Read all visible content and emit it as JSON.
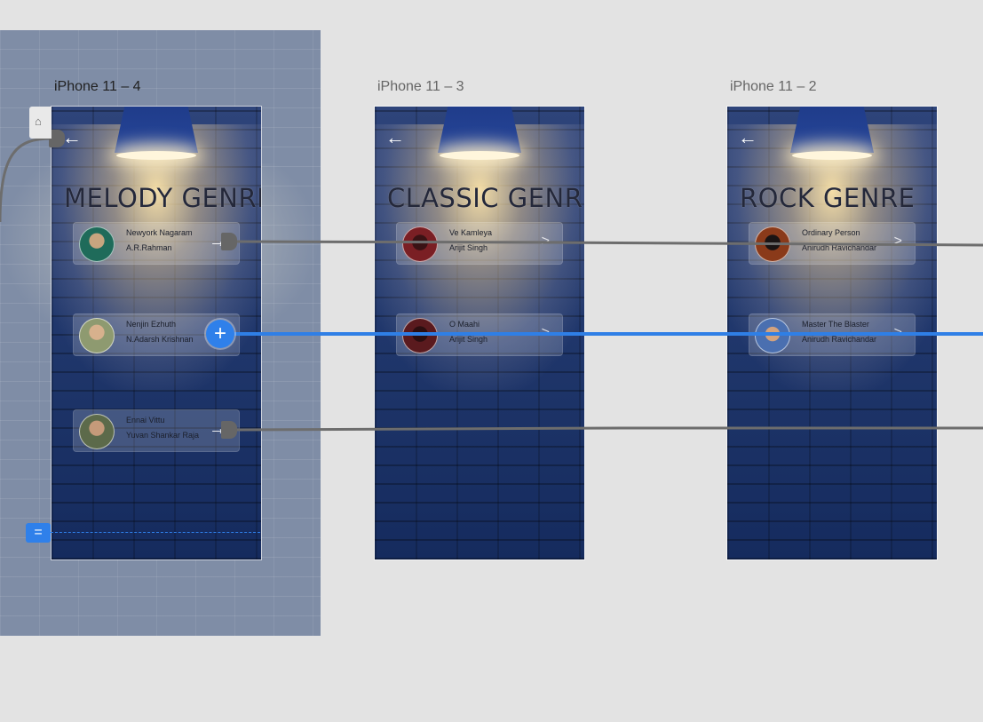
{
  "frames": [
    {
      "label": "iPhone 11 – 4",
      "title": "MELODY GENRE",
      "back_icon": "←",
      "songs": [
        {
          "song": "Newyork Nagaram",
          "artist": "A.R.Rahman",
          "avatar_color": "#1f6b5a",
          "arrow": "→"
        },
        {
          "song": "Nenjin Ezhuth",
          "artist": "N.Adarsh Krishnan",
          "avatar_color": "#c9a27a",
          "arrow": "→"
        },
        {
          "song": "Ennai Vittu",
          "artist": "Yuvan Shankar Raja",
          "avatar_color": "#5c6a4a",
          "arrow": "→"
        }
      ]
    },
    {
      "label": "iPhone 11 – 3",
      "title": "CLASSIC GENRE",
      "back_icon": "←",
      "songs": [
        {
          "song": "Ve Kamleya",
          "artist": "Arijit Singh",
          "avatar_color": "#7a1f24",
          "arrow": ">"
        },
        {
          "song": "O Maahi",
          "artist": "Arijit Singh",
          "avatar_color": "#5a1a1e",
          "arrow": ">"
        }
      ]
    },
    {
      "label": "iPhone 11 – 2",
      "title": "ROCK GENRE",
      "back_icon": "←",
      "songs": [
        {
          "song": "Ordinary Person",
          "artist": "Anirudh Ravichandar",
          "avatar_color": "#8a3a1a",
          "arrow": ">"
        },
        {
          "song": "Master The Blaster",
          "artist": "Anirudh Ravichandar",
          "avatar_color": "#4a6fb0",
          "arrow": ">"
        }
      ]
    }
  ],
  "ui": {
    "add_icon": "+",
    "home_icon": "⌂",
    "scroll_icon": "=",
    "accent_color": "#2f80ea",
    "wire_color": "#6d6d6d"
  }
}
